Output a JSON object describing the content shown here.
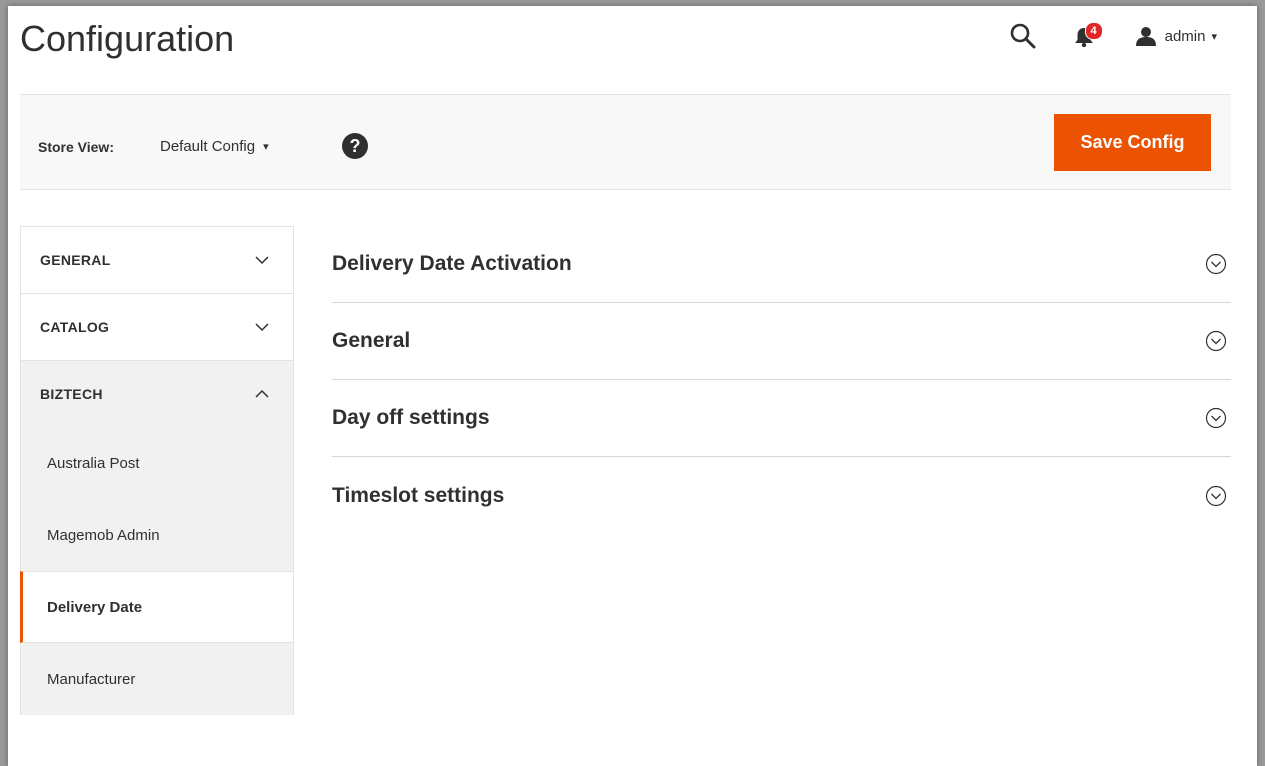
{
  "header": {
    "title": "Configuration",
    "notification_count": "4",
    "user_name": "admin",
    "caret": "▾"
  },
  "store_bar": {
    "label": "Store View:",
    "selected": "Default Config",
    "help": "?",
    "save_label": "Save Config"
  },
  "sidebar": {
    "sections": [
      {
        "label": "GENERAL",
        "open": false
      },
      {
        "label": "CATALOG",
        "open": false
      },
      {
        "label": "BIZTECH",
        "open": true
      }
    ],
    "items": [
      {
        "label": "Australia Post",
        "active": false
      },
      {
        "label": "Magemob Admin",
        "active": false
      },
      {
        "label": "Delivery Date",
        "active": true
      },
      {
        "label": "Manufacturer",
        "active": false
      }
    ]
  },
  "content": {
    "sections": [
      {
        "title": "Delivery Date Activation"
      },
      {
        "title": "General"
      },
      {
        "title": "Day off settings"
      },
      {
        "title": "Timeslot settings"
      }
    ]
  },
  "colors": {
    "accent": "#eb5202",
    "badge": "#e22626",
    "text": "#303030"
  }
}
